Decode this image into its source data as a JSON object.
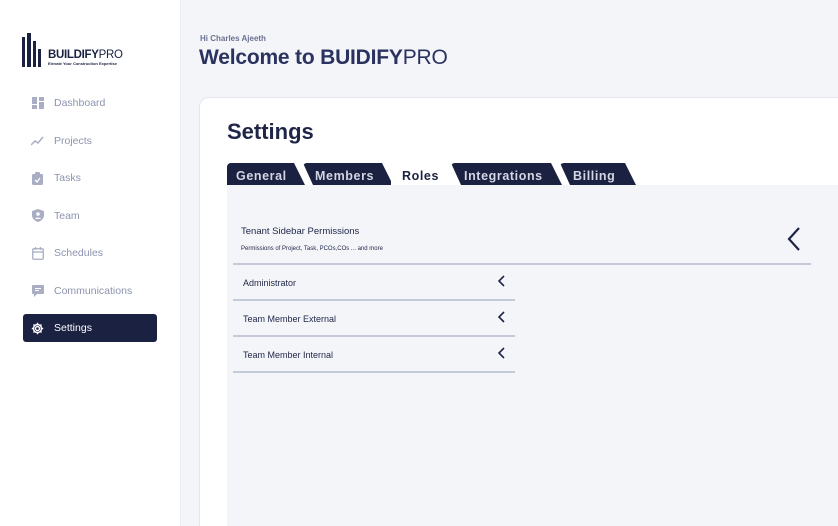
{
  "app": {
    "brand_bold": "BUILDIFY",
    "brand_light": "PRO",
    "tagline": "Elevate Your Construction Expertise"
  },
  "sidebar": {
    "items": [
      {
        "label": "Dashboard",
        "icon": "dashboard-icon"
      },
      {
        "label": "Projects",
        "icon": "trend-line-icon"
      },
      {
        "label": "Tasks",
        "icon": "clipboard-icon"
      },
      {
        "label": "Team",
        "icon": "shield-user-icon"
      },
      {
        "label": "Schedules",
        "icon": "calendar-icon"
      },
      {
        "label": "Communications",
        "icon": "chat-icon"
      },
      {
        "label": "Settings",
        "icon": "gear-icon",
        "active": true
      }
    ]
  },
  "header": {
    "greeting": "Hi Charles Ajeeth",
    "welcome_bold": "Welcome to BUIDIFY",
    "welcome_light": "PRO"
  },
  "settings": {
    "title": "Settings",
    "tabs": [
      {
        "label": "General"
      },
      {
        "label": "Members"
      },
      {
        "label": "Roles",
        "active": true
      },
      {
        "label": "Integrations"
      },
      {
        "label": "Billing"
      }
    ],
    "permissions": {
      "title": "Tenant Sidebar Permissions",
      "subtitle": "Permissions of Project, Task, PCOs,COs ... and more"
    },
    "roles": [
      {
        "label": "Administrator"
      },
      {
        "label": "Team Member External"
      },
      {
        "label": "Team Member Internal"
      }
    ]
  },
  "colors": {
    "primary": "#1b2141",
    "muted_text": "#8c93ad",
    "background": "#f4f5f9",
    "divider": "#c5cad8"
  }
}
